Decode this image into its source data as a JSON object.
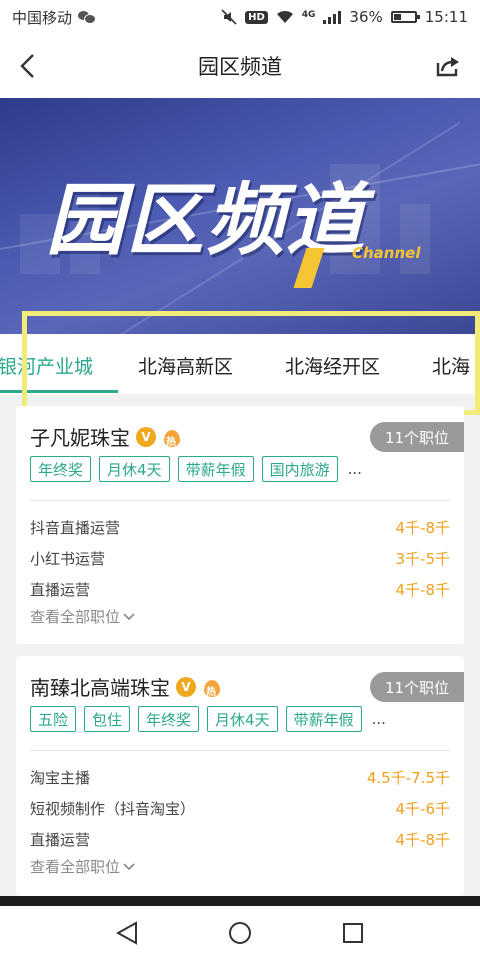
{
  "status_bar": {
    "carrier": "中国移动",
    "hd": "HD",
    "network": "4G",
    "battery": "36%",
    "battery_level": 0.36,
    "time": "15:11"
  },
  "header": {
    "title": "园区频道"
  },
  "banner": {
    "title": "园区频道",
    "subtitle": "Channel"
  },
  "tabs": [
    {
      "label": "银河产业城",
      "active": true
    },
    {
      "label": "北海高新区",
      "active": false
    },
    {
      "label": "北海经开区",
      "active": false
    },
    {
      "label": "北海",
      "active": false
    }
  ],
  "cards": [
    {
      "company": "子凡妮珠宝",
      "job_count": "11个职位",
      "tags": [
        "年终奖",
        "月休4天",
        "带薪年假",
        "国内旅游"
      ],
      "more": "...",
      "jobs": [
        {
          "title": "抖音直播运营",
          "salary": "4千-8千"
        },
        {
          "title": "小红书运营",
          "salary": "3千-5千"
        },
        {
          "title": "直播运营",
          "salary": "4千-8千"
        }
      ],
      "see_all": "查看全部职位"
    },
    {
      "company": "南臻北高端珠宝",
      "job_count": "11个职位",
      "tags": [
        "五险",
        "包住",
        "年终奖",
        "月休4天",
        "带薪年假"
      ],
      "more": "...",
      "jobs": [
        {
          "title": "淘宝主播",
          "salary": "4.5千-7.5千"
        },
        {
          "title": "短视频制作（抖音淘宝）",
          "salary": "4千-6千"
        },
        {
          "title": "直播运营",
          "salary": "4千-8千"
        }
      ],
      "see_all": "查看全部职位"
    }
  ],
  "colors": {
    "accent": "#2ca88e",
    "salary": "#f0a020",
    "badge": "#9a9a9a"
  }
}
